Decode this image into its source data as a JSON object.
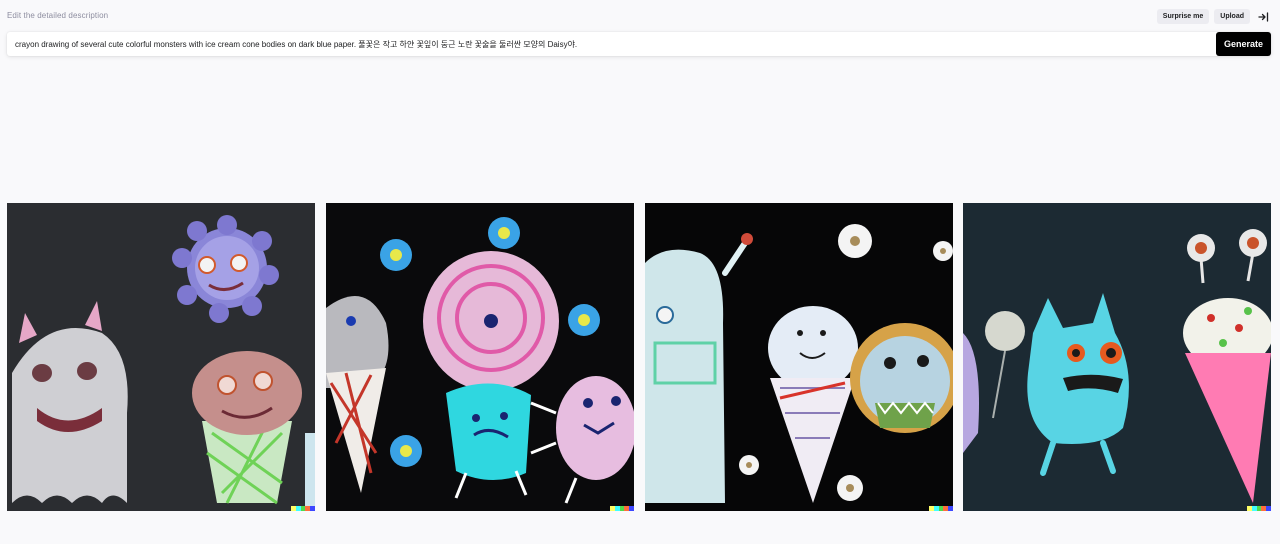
{
  "header": {
    "hint": "Edit the detailed description",
    "surprise_label": "Surprise me",
    "upload_label": "Upload",
    "exit_icon": "exit-icon"
  },
  "prompt": {
    "value": "crayon drawing of several cute colorful monsters with ice cream cone bodies on dark blue paper. 풀꽃은 작고 하얀 꽃잎이 둥근 노란 꽃술을 둘러싼 모양의 Daisy야.",
    "generate_label": "Generate"
  },
  "results": {
    "count": 4,
    "signature_colors": [
      "#ffff66",
      "#42ffff",
      "#51da4c",
      "#ff6e3c",
      "#3c46ff"
    ]
  }
}
